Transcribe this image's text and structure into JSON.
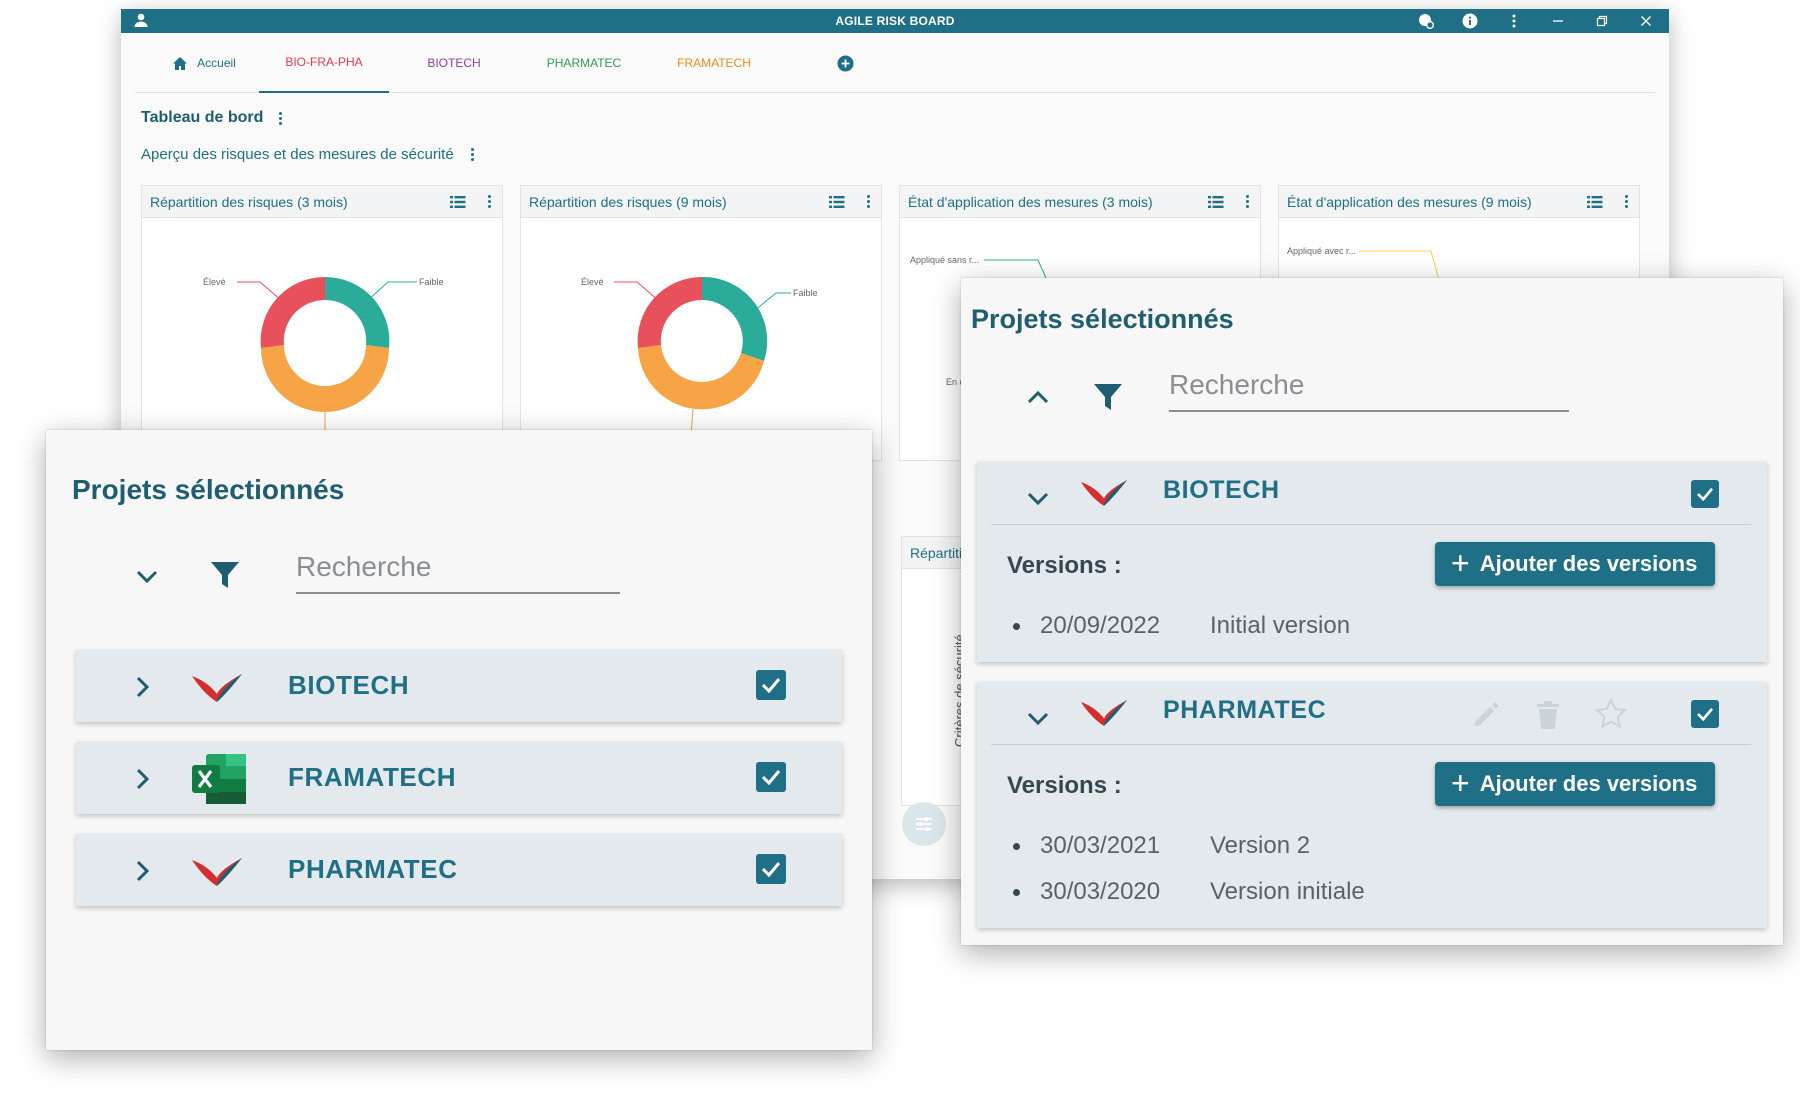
{
  "window": {
    "title": "AGILE RISK BOARD"
  },
  "tabs": [
    {
      "label": "Accueil",
      "color": "#1f6f86"
    },
    {
      "label": "BIO-FRA-PHA",
      "color": "#e53950"
    },
    {
      "label": "BIOTECH",
      "color": "#8e3d9e"
    },
    {
      "label": "PHARMATEC",
      "color": "#2e9a50"
    },
    {
      "label": "FRAMATECH",
      "color": "#f08a1c"
    }
  ],
  "dashboard": {
    "title": "Tableau de bord",
    "subtitle": "Aperçu des risques et des mesures de sécurité",
    "cards": [
      {
        "title": "Répartition des risques (3 mois)",
        "labels": [
          "Élevé",
          "Faible"
        ]
      },
      {
        "title": "Répartition des risques (9 mois)",
        "labels": [
          "Élevé",
          "Faible"
        ]
      },
      {
        "title": "État d'application des mesures (3 mois)",
        "labels": [
          "Appliqué sans r...",
          "En c"
        ]
      },
      {
        "title": "État d'application des mesures (9 mois)",
        "labels": [
          "Appliqué avec r..."
        ]
      }
    ],
    "lower_card": {
      "title": "Répartiti",
      "axis_label": "Critères de sécurité"
    }
  },
  "colors": {
    "primary": "#1f6f86",
    "red": "#e8505b",
    "teal": "#2bab9a",
    "orange": "#f6a445"
  },
  "left_panel": {
    "title": "Projets sélectionnés",
    "search_placeholder": "Recherche",
    "projects": [
      {
        "name": "BIOTECH",
        "logo": "bird-logo",
        "checked": true
      },
      {
        "name": "FRAMATECH",
        "logo": "excel-logo",
        "checked": true
      },
      {
        "name": "PHARMATEC",
        "logo": "bird-logo",
        "checked": true
      }
    ]
  },
  "right_panel": {
    "title": "Projets sélectionnés",
    "search_placeholder": "Recherche",
    "projects": [
      {
        "name": "BIOTECH",
        "versions_label": "Versions :",
        "add_label": "Ajouter des versions",
        "versions": [
          {
            "date": "20/09/2022",
            "name": "Initial version"
          }
        ]
      },
      {
        "name": "PHARMATEC",
        "versions_label": "Versions :",
        "add_label": "Ajouter des versions",
        "versions": [
          {
            "date": "30/03/2021",
            "name": "Version 2"
          },
          {
            "date": "30/03/2020",
            "name": "Version initiale"
          }
        ]
      }
    ]
  }
}
